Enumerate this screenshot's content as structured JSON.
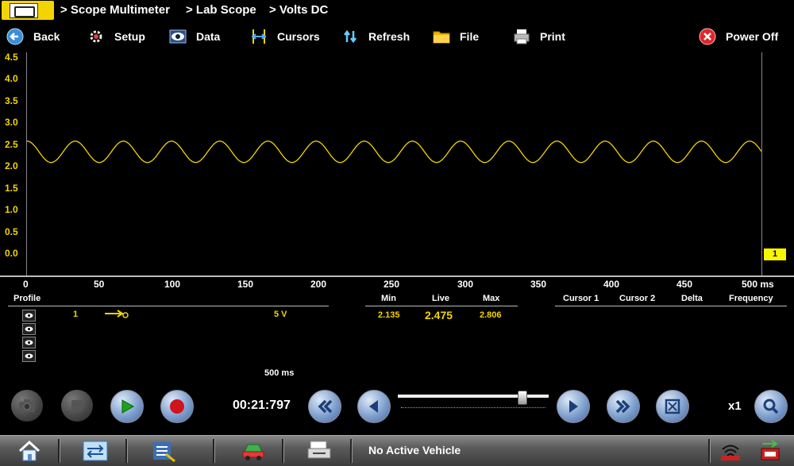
{
  "breadcrumb": [
    "> Scope Multimeter",
    "> Lab Scope",
    "> Volts DC"
  ],
  "toolbar": {
    "back": "Back",
    "setup": "Setup",
    "data": "Data",
    "cursors": "Cursors",
    "refresh": "Refresh",
    "file": "File",
    "print": "Print",
    "power_off": "Power Off"
  },
  "colors": {
    "trace": "#f3d400",
    "plot_bg": "#000000",
    "accent_yellow": "#f7f700"
  },
  "chart_data": {
    "type": "line",
    "y_ticks": [
      "4.5",
      "4.0",
      "3.5",
      "3.0",
      "2.5",
      "2.0",
      "1.5",
      "1.0",
      "0.5",
      "0.0"
    ],
    "x_ticks": [
      "0",
      "50",
      "100",
      "150",
      "200",
      "250",
      "300",
      "350",
      "400",
      "450",
      "500 ms"
    ],
    "xlim": [
      0,
      500
    ],
    "ylim": [
      -0.1,
      4.5
    ],
    "series": [
      {
        "name": "1",
        "waveform": "sine",
        "mean": 2.45,
        "amplitude": 0.22,
        "period_ms": 32.8,
        "phase_ms": 0
      }
    ],
    "trace_marker": "1"
  },
  "profile": {
    "header": "Profile",
    "trace_number": "1",
    "scale": "5 V",
    "sweep": "500 ms"
  },
  "measurements": {
    "min_label": "Min",
    "live_label": "Live",
    "max_label": "Max",
    "min": "2.135",
    "live": "2.475",
    "max": "2.806"
  },
  "cursor_table": {
    "cursor1": "Cursor 1",
    "cursor2": "Cursor 2",
    "delta": "Delta",
    "frequency": "Frequency"
  },
  "playback": {
    "time": "00:21:797",
    "zoom": "x1",
    "slider_position": 0.82
  },
  "taskbar": {
    "status": "No Active Vehicle"
  }
}
